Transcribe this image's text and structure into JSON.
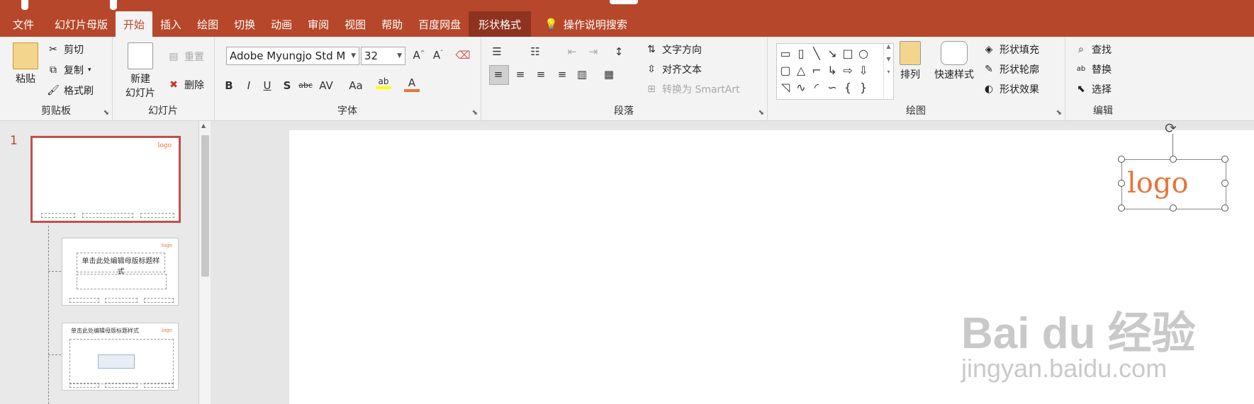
{
  "ribbon_tabs": {
    "file": "文件",
    "slide_master": "幻灯片母版",
    "home": "开始",
    "insert": "插入",
    "draw": "绘图",
    "transitions": "切换",
    "animations": "动画",
    "review": "审阅",
    "view": "视图",
    "help": "帮助",
    "baidu_netdisk": "百度网盘",
    "shape_format": "形状格式",
    "tell_me": "操作说明搜索"
  },
  "clipboard": {
    "paste": "粘贴",
    "cut": "剪切",
    "copy": "复制",
    "format_painter": "格式刷",
    "label": "剪贴板"
  },
  "slides": {
    "new_slide_1": "新建",
    "new_slide_2": "幻灯片",
    "reset": "重置",
    "delete": "删除",
    "label": "幻灯片"
  },
  "font": {
    "name": "Adobe Myungjo Std M",
    "size": "32",
    "bold": "B",
    "italic": "I",
    "underline": "U",
    "shadow": "S",
    "strike": "abc",
    "spacing": "AV",
    "case": "Aa",
    "highlight": "ab",
    "color_a": "A",
    "label": "字体",
    "color_accent": "#e8743b",
    "highlight_color": "#ffff00"
  },
  "paragraph": {
    "text_direction": "文字方向",
    "align_text": "对齐文本",
    "convert_smartart": "转换为 SmartArt",
    "label": "段落"
  },
  "drawing": {
    "arrange": "排列",
    "quick_styles": "快速样式",
    "shape_fill": "形状填充",
    "shape_outline": "形状轮廓",
    "shape_effects": "形状效果",
    "label": "绘图"
  },
  "editing": {
    "find": "查找",
    "replace": "替换",
    "select": "选择",
    "label": "编辑"
  },
  "thumbnails": {
    "slide_number": "1",
    "logo": "logo",
    "layout1_title": "单击此处编辑母版标题样式",
    "layout2_title": "单击此处编辑母版标题样式"
  },
  "slide": {
    "logo": "logo"
  },
  "watermark": {
    "brand": "Bai du 经验",
    "url": "jingyan.baidu.com"
  },
  "colors": {
    "accent": "#b7472a",
    "logo": "#e8743b",
    "context_tab": "#8e331f"
  }
}
